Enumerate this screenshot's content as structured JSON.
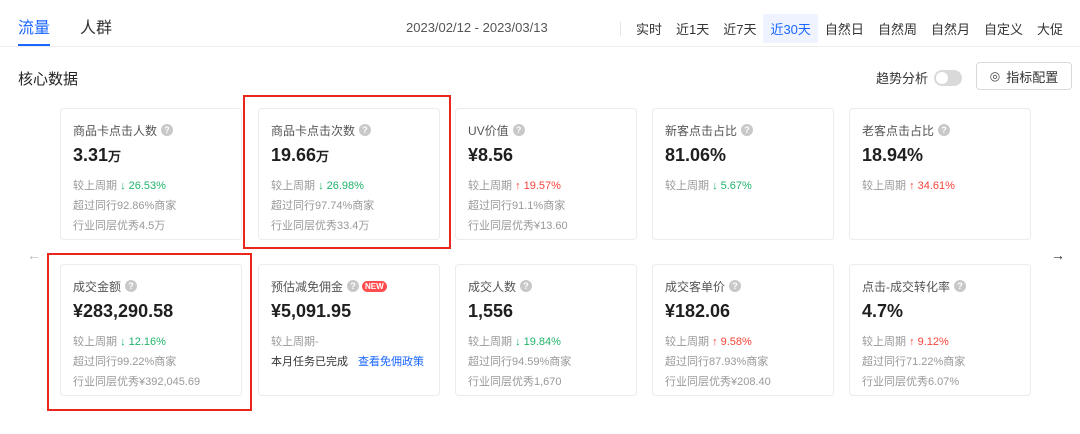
{
  "tabs": [
    {
      "label": "流量",
      "active": true
    },
    {
      "label": "人群",
      "active": false
    }
  ],
  "date_range": "2023/02/12 - 2023/03/13",
  "range_buttons": [
    {
      "label": "实时",
      "active": false
    },
    {
      "label": "近1天",
      "active": false
    },
    {
      "label": "近7天",
      "active": false
    },
    {
      "label": "近30天",
      "active": true
    },
    {
      "label": "自然日",
      "active": false
    },
    {
      "label": "自然周",
      "active": false
    },
    {
      "label": "自然月",
      "active": false
    },
    {
      "label": "自定义",
      "active": false
    },
    {
      "label": "大促",
      "active": false
    }
  ],
  "section": {
    "title": "核心数据",
    "trend_label": "趋势分析",
    "trend_enabled": false,
    "config_label": "指标配置",
    "config_icon": "settings-icon"
  },
  "colors": {
    "accent": "#1a66ff",
    "up": "#f5443a",
    "down": "#21b36b",
    "highlight": "#e8261c"
  },
  "cards": [
    {
      "title": "商品卡点击人数",
      "value": "3.31",
      "unit": "万",
      "compare_label": "较上周期",
      "trend": "down",
      "change": "26.53%",
      "peer": "超过同行92.86%商家",
      "excellent": "行业同层优秀4.5万",
      "highlighted": false
    },
    {
      "title": "商品卡点击次数",
      "value": "19.66",
      "unit": "万",
      "compare_label": "较上周期",
      "trend": "down",
      "change": "26.98%",
      "peer": "超过同行97.74%商家",
      "excellent": "行业同层优秀33.4万",
      "highlighted": true
    },
    {
      "title": "UV价值",
      "value": "¥8.56",
      "unit": "",
      "compare_label": "较上周期",
      "trend": "up",
      "change": "19.57%",
      "peer": "超过同行91.1%商家",
      "excellent": "行业同层优秀¥13.60",
      "highlighted": false
    },
    {
      "title": "新客点击占比",
      "value": "81.06%",
      "unit": "",
      "compare_label": "较上周期",
      "trend": "down",
      "change": "5.67%",
      "peer": "",
      "excellent": "",
      "highlighted": false
    },
    {
      "title": "老客点击占比",
      "value": "18.94%",
      "unit": "",
      "compare_label": "较上周期",
      "trend": "up",
      "change": "34.61%",
      "peer": "",
      "excellent": "",
      "highlighted": false
    },
    {
      "title": "成交金额",
      "value": "¥283,290.58",
      "unit": "",
      "compare_label": "较上周期",
      "trend": "down",
      "change": "12.16%",
      "peer": "超过同行99.22%商家",
      "excellent": "行业同层优秀¥392,045.69",
      "highlighted": true
    },
    {
      "title": "预估减免佣金",
      "badge": "NEW",
      "value": "¥5,091.95",
      "unit": "",
      "compare_label": "较上周期-",
      "trend": "",
      "change": "",
      "task_status": "本月任务已完成",
      "task_link": "查看免佣政策",
      "highlighted": false
    },
    {
      "title": "成交人数",
      "value": "1,556",
      "unit": "",
      "compare_label": "较上周期",
      "trend": "down",
      "change": "19.84%",
      "peer": "超过同行94.59%商家",
      "excellent": "行业同层优秀1,670",
      "highlighted": false
    },
    {
      "title": "成交客单价",
      "value": "¥182.06",
      "unit": "",
      "compare_label": "较上周期",
      "trend": "up",
      "change": "9.58%",
      "peer": "超过同行87.93%商家",
      "excellent": "行业同层优秀¥208.40",
      "highlighted": false
    },
    {
      "title": "点击-成交转化率",
      "value": "4.7%",
      "unit": "",
      "compare_label": "较上周期",
      "trend": "up",
      "change": "9.12%",
      "peer": "超过同行71.22%商家",
      "excellent": "行业同层优秀6.07%",
      "highlighted": false
    }
  ]
}
